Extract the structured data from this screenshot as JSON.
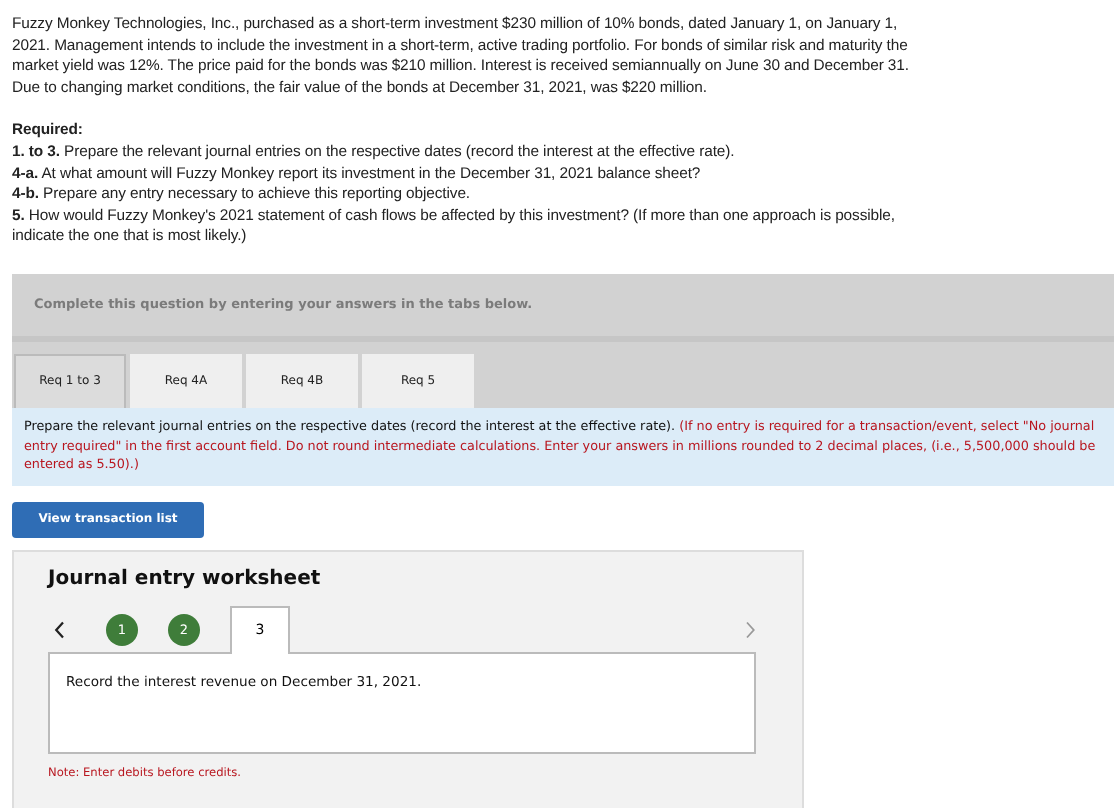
{
  "problem_lines": [
    "Fuzzy Monkey Technologies, Inc., purchased as a short-term investment $230 million of 10% bonds, dated January 1, on January 1,",
    "2021. Management intends to include the investment in a short-term, active trading portfolio. For bonds of similar risk and maturity the",
    "market yield was 12%. The price paid for the bonds was $210 million. Interest is received semiannually on June 30 and December 31.",
    "Due to changing market conditions, the fair value of the bonds at December 31, 2021, was $220 million."
  ],
  "required_heading": "Required:",
  "required_lines": [
    "**1. to 3.** Prepare the relevant journal entries on the respective dates (record the interest at the effective rate).",
    "**4-a.** At what amount will Fuzzy Monkey report its investment in the December 31, 2021 balance sheet?",
    "**4-b.** Prepare any entry necessary to achieve this reporting objective.",
    "**5.** How would Fuzzy Monkey's 2021 statement of cash flows be affected by this investment? (If more than one approach is possible,",
    "indicate the one that is most likely.)"
  ],
  "panel_header": "Complete this question by entering your answers in the tabs below.",
  "tabs": [
    {
      "label": "Req 1 to 3",
      "selected": true
    },
    {
      "label": "Req 4A",
      "selected": false
    },
    {
      "label": "Req 4B",
      "selected": false
    },
    {
      "label": "Req 5",
      "selected": false
    }
  ],
  "instruction": "Prepare the relevant journal entries on the respective dates (record the interest at the effective rate).",
  "instruction_note": "(If no entry is required for a transaction/event, select \"No journal entry required\" in the first account field. Do not round intermediate calculations. Enter your answers in millions rounded to 2 decimal places, (i.e., 5,500,000 should be entered as 5.50).)",
  "view_button": "View transaction list",
  "worksheet": {
    "title": "Journal entry worksheet",
    "prev_disabled": false,
    "next_disabled": true,
    "steps": [
      {
        "label": "1",
        "selected": false
      },
      {
        "label": "2",
        "selected": false
      },
      {
        "label": "3",
        "selected": true
      }
    ],
    "prompt": "Record the interest revenue on December 31, 2021.",
    "note": "Note: Enter debits before credits."
  }
}
